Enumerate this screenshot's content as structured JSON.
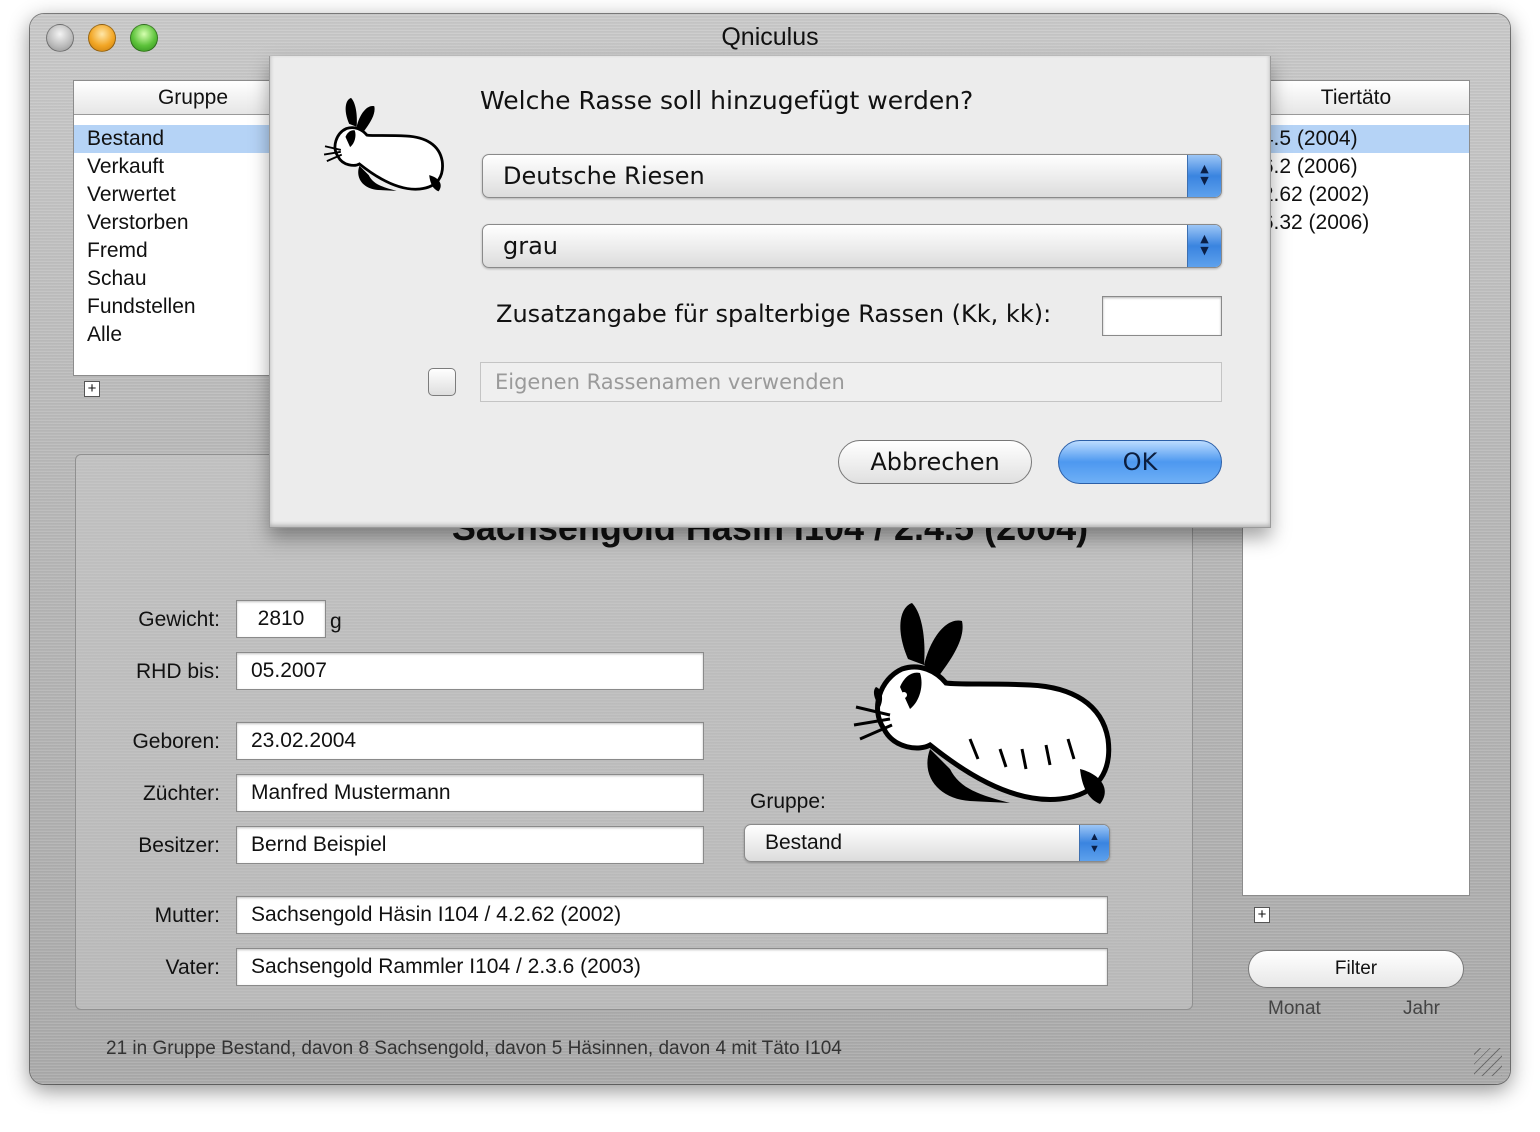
{
  "window": {
    "title": "Qniculus"
  },
  "left_list": {
    "header": "Gruppe",
    "items": [
      "Bestand",
      "Verkauft",
      "Verwertet",
      "Verstorben",
      "Fremd",
      "Schau",
      "Fundstellen",
      "Alle"
    ],
    "selected": "Bestand"
  },
  "right_list": {
    "header": "Tiertäto",
    "items": [
      ".4.5 (2004)",
      ".6.2 (2006)",
      ".2.62 (2002)",
      ".6.32 (2006)"
    ]
  },
  "detail": {
    "name": "Sachsengold Häsin I104 / 2.4.5 (2004)",
    "gewicht_label": "Gewicht:",
    "gewicht_value": "2810",
    "gewicht_unit": "g",
    "rhd_label": "RHD bis:",
    "rhd_value": "05.2007",
    "geboren_label": "Geboren:",
    "geboren_value": "23.02.2004",
    "zuechter_label": "Züchter:",
    "zuechter_value": "Manfred Mustermann",
    "besitzer_label": "Besitzer:",
    "besitzer_value": "Bernd Beispiel",
    "gruppe_label": "Gruppe:",
    "gruppe_value": "Bestand",
    "mutter_label": "Mutter:",
    "mutter_value": "Sachsengold Häsin I104 / 4.2.62 (2002)",
    "vater_label": "Vater:",
    "vater_value": "Sachsengold Rammler I104 / 2.3.6 (2003)"
  },
  "filter": {
    "button": "Filter",
    "monat": "Monat",
    "jahr": "Jahr"
  },
  "status": "21 in Gruppe Bestand, davon 8 Sachsengold, davon 5 Häsinnen, davon 4 mit Täto I104",
  "dialog": {
    "question": "Welche Rasse soll hinzugefügt werden?",
    "rasse_value": "Deutsche Riesen",
    "farbe_value": "grau",
    "zusatz_label": "Zusatzangabe für spalterbige Rassen (Kk, kk):",
    "zusatz_value": "",
    "own_name_placeholder": "Eigenen Rassenamen verwenden",
    "cancel_label": "Abbrechen",
    "ok_label": "OK"
  },
  "icons": {
    "window": [
      "close-icon",
      "minimize-icon",
      "zoom-icon"
    ],
    "illustration": "rabbit-icon"
  }
}
